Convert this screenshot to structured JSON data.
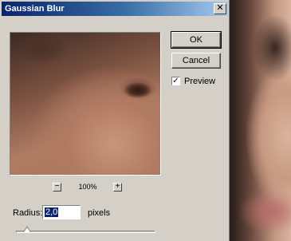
{
  "window": {
    "title": "Gaussian Blur",
    "close_glyph": "✕"
  },
  "buttons": {
    "ok_label": "OK",
    "cancel_label": "Cancel"
  },
  "preview": {
    "label": "Preview",
    "checked": true,
    "check_glyph": "✓"
  },
  "zoom": {
    "minus_glyph": "−",
    "plus_glyph": "+",
    "level": "100%"
  },
  "radius": {
    "label": "Radius:",
    "value": "2,0",
    "units": "pixels",
    "slider_fraction": 0.08
  },
  "icons": {
    "close": "close-icon",
    "zoom_out": "minus-icon",
    "zoom_in": "plus-icon",
    "checkmark": "checkmark-icon"
  }
}
